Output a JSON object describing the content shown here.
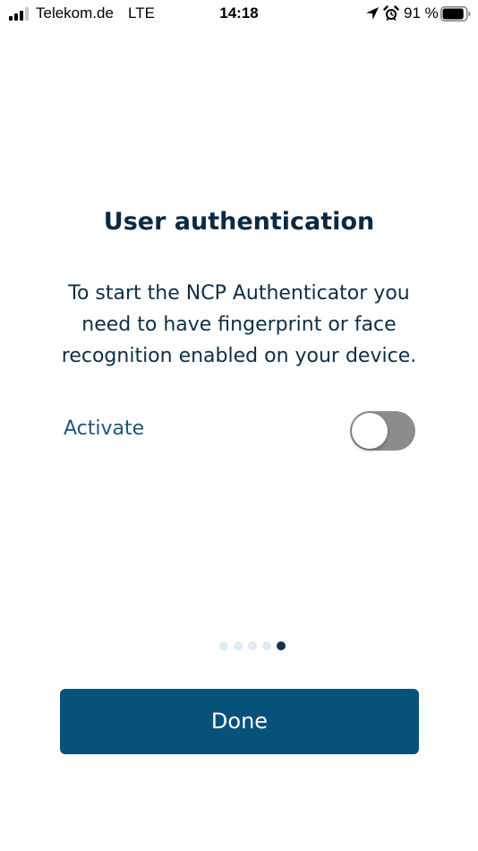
{
  "status_bar": {
    "carrier": "Telekom.de",
    "network": "LTE",
    "time": "14:18",
    "battery_percent": "91 %",
    "icons": [
      "signal-bars-icon",
      "location-arrow-icon",
      "alarm-clock-icon",
      "battery-icon"
    ],
    "battery_level": 0.91,
    "signal_bars_filled": 3
  },
  "screen": {
    "title": "User authentication",
    "description": "To start the NCP Authenticator you need to have fingerprint or face recognition enabled on your device.",
    "activate_label": "Activate",
    "activate_toggle_on": false
  },
  "pager": {
    "total_pages": 5,
    "current_page": 5
  },
  "footer": {
    "done_label": "Done"
  },
  "colors": {
    "title_text": "#0a2a44",
    "body_text": "#0d2e45",
    "label_text": "#1f5576",
    "toggle_off": "#8c8c8c",
    "button_bg": "#07527a",
    "dot_inactive": "#dcebf6",
    "dot_active": "#0d3553"
  }
}
